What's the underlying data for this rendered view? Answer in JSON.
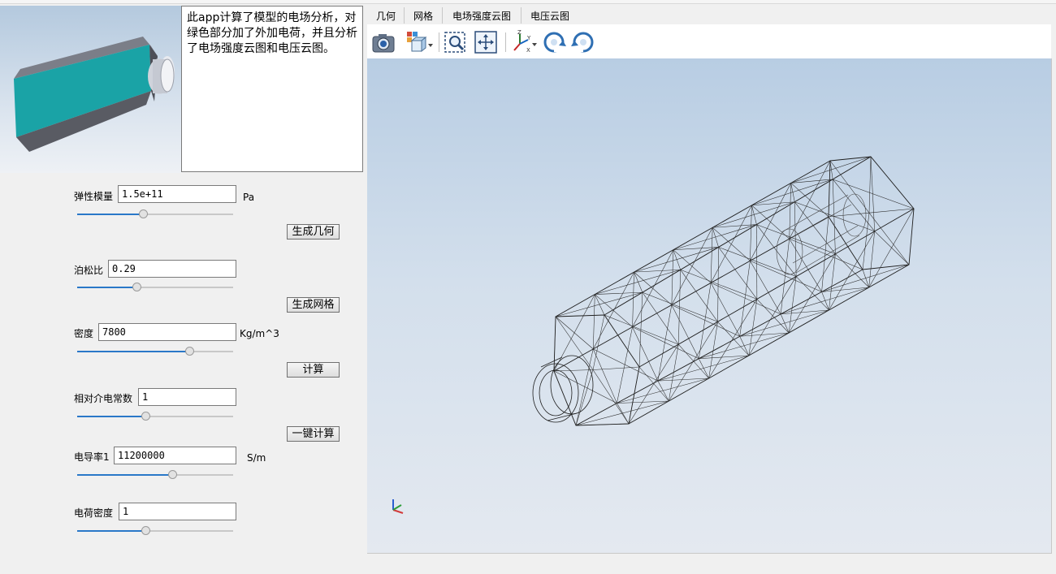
{
  "description": "此app计算了模型的电场分析，对绿色部分加了外加电荷，并且分析了电场强度云图和电压云图。",
  "params": {
    "elastic_modulus": {
      "label": "弹性模量",
      "value": "1.5e+11",
      "unit": "Pa",
      "slider": 0.42
    },
    "poisson_ratio": {
      "label": "泊松比",
      "value": "0.29",
      "slider": 0.38
    },
    "density": {
      "label": "密度",
      "value": "7800",
      "unit": "Kg/m^3",
      "slider": 0.72
    },
    "relative_permittivity": {
      "label": "相对介电常数",
      "value": "1",
      "slider": 0.44
    },
    "conductivity": {
      "label": "电导率1",
      "value": "11200000",
      "unit": "S/m",
      "slider": 0.61
    },
    "charge_density": {
      "label": "电荷密度",
      "value": "1",
      "slider": 0.44
    }
  },
  "buttons": {
    "generate_geometry": "生成几何",
    "generate_mesh": "生成网格",
    "compute": "计算",
    "one_click_compute": "一键计算"
  },
  "tabs": [
    "几何",
    "网格",
    "电场强度云图",
    "电压云图"
  ],
  "toolbar": {
    "icons": [
      "camera-icon",
      "view-cube-icon",
      "zoom-window-icon",
      "fit-all-icon",
      "axes-orientation-icon",
      "rotate-cw-icon",
      "rotate-ccw-icon"
    ]
  },
  "colors": {
    "model_face": "#1aa3a6",
    "model_body": "#5a5c64",
    "slider_fill": "#2a78c8",
    "viewport_top": "#b8cde3",
    "viewport_bottom": "#e4e9f0"
  }
}
